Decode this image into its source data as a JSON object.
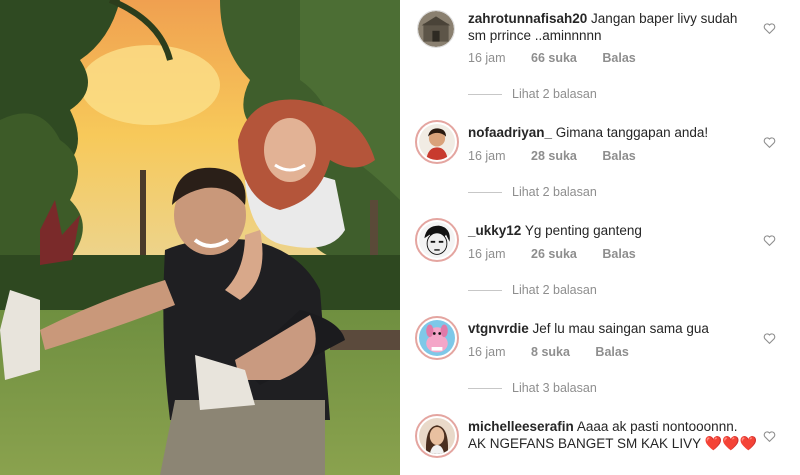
{
  "photo": {
    "alt": "couple photo in park at sunset"
  },
  "comments": [
    {
      "username": "zahrotunnafisah20",
      "text": "Jangan baper livy sudah sm prrince ..aminnnnn",
      "time": "16 jam",
      "likes": "66 suka",
      "reply": "Balas",
      "view_replies": "Lihat 2 balasan",
      "avatar_icon": "building-photo"
    },
    {
      "username": "nofaadriyan_",
      "text": "Gimana tanggapan anda!",
      "time": "16 jam",
      "likes": "28 suka",
      "reply": "Balas",
      "view_replies": "Lihat 2 balasan",
      "avatar_icon": "cartoon-man"
    },
    {
      "username": "_ukky12",
      "text": "Yg penting ganteng",
      "time": "16 jam",
      "likes": "26 suka",
      "reply": "Balas",
      "view_replies": "Lihat 2 balasan",
      "avatar_icon": "manga-face"
    },
    {
      "username": "vtgnvrdie",
      "text": "Jef lu mau saingan sama gua",
      "time": "16 jam",
      "likes": "8 suka",
      "reply": "Balas",
      "view_replies": "Lihat 3 balasan",
      "avatar_icon": "pink-cartoon-dog"
    },
    {
      "username": "michelleeserafin",
      "text": "Aaaa ak pasti nontooonnn. AK NGEFANS BANGET SM KAK LIVY",
      "emoji": "❤️❤️❤️",
      "avatar_icon": "woman-selfie"
    }
  ],
  "colors": {
    "ring": "#e4a5a0",
    "meta": "#8e8e8e",
    "text": "#262626",
    "heart_red": "#ed4956"
  }
}
